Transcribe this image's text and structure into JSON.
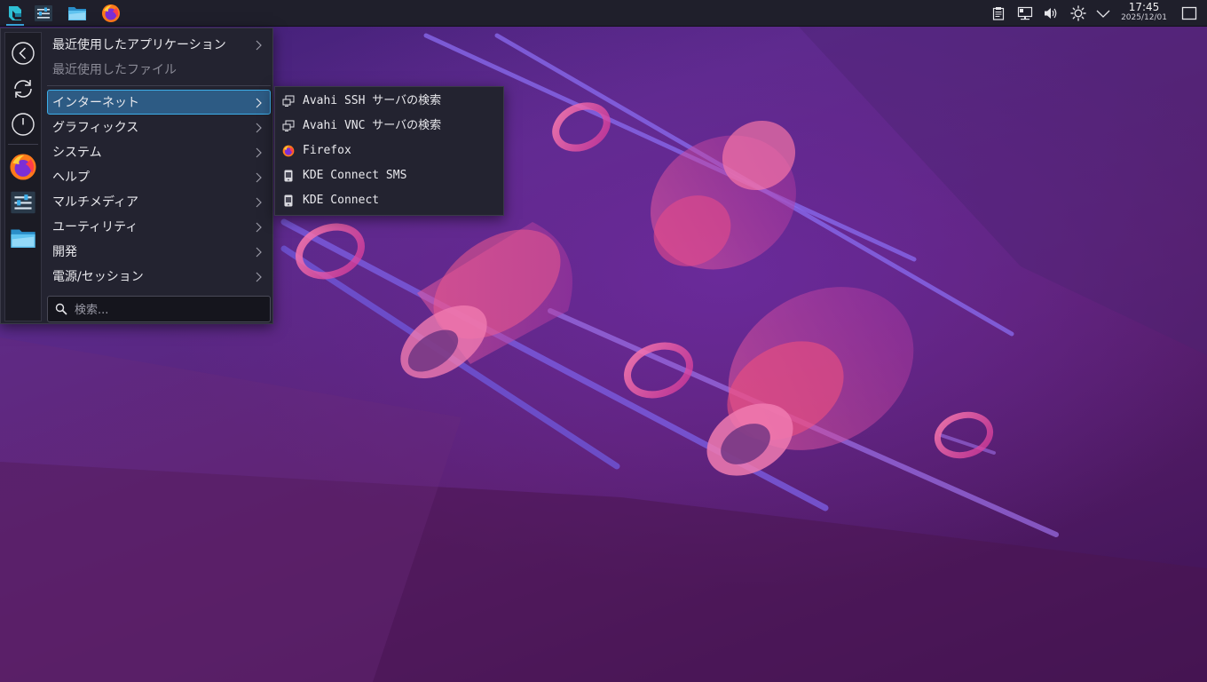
{
  "panel": {
    "launchers": [
      {
        "name": "application-launcher",
        "icon": "kde-launcher-icon"
      },
      {
        "name": "system-settings",
        "icon": "settings-sliders-icon"
      },
      {
        "name": "file-manager",
        "icon": "folder-icon"
      },
      {
        "name": "firefox",
        "icon": "firefox-icon"
      }
    ],
    "tray_icons": [
      "clipboard-icon",
      "network-icon",
      "volume-icon",
      "brightness-icon",
      "tray-expand-icon"
    ],
    "clock": {
      "time": "17:45",
      "date": "2025/12/01"
    },
    "show_desktop_icon": "show-desktop-icon"
  },
  "menu": {
    "favorites_column": {
      "actions": [
        "back-icon",
        "refresh-icon",
        "power-icon"
      ],
      "favorites": [
        "firefox-icon",
        "settings-sliders-icon",
        "folder-icon"
      ]
    },
    "categories_top": [
      {
        "label": "最近使用したアプリケーション",
        "disabled": false
      },
      {
        "label": "最近使用したファイル",
        "disabled": true
      }
    ],
    "categories": [
      {
        "label": "インターネット",
        "selected": true
      },
      {
        "label": "グラフィックス"
      },
      {
        "label": "システム"
      },
      {
        "label": "ヘルプ"
      },
      {
        "label": "マルチメディア"
      },
      {
        "label": "ユーティリティ"
      },
      {
        "label": "開発"
      },
      {
        "label": "電源/セッション"
      }
    ],
    "search": {
      "placeholder": "検索..."
    }
  },
  "submenu": {
    "items": [
      {
        "label": "Avahi SSH サーバの検索",
        "icon": "network-browse-icon"
      },
      {
        "label": "Avahi VNC サーバの検索",
        "icon": "network-browse-icon"
      },
      {
        "label": "Firefox",
        "icon": "firefox-icon"
      },
      {
        "label": "KDE Connect SMS",
        "icon": "kdeconnect-sms-icon"
      },
      {
        "label": "KDE Connect",
        "icon": "kdeconnect-icon"
      }
    ]
  },
  "colors": {
    "accent": "#3daee9",
    "selection": "#2d5b84",
    "panel_bg": "#1f1f2b",
    "menu_bg": "#232330"
  }
}
